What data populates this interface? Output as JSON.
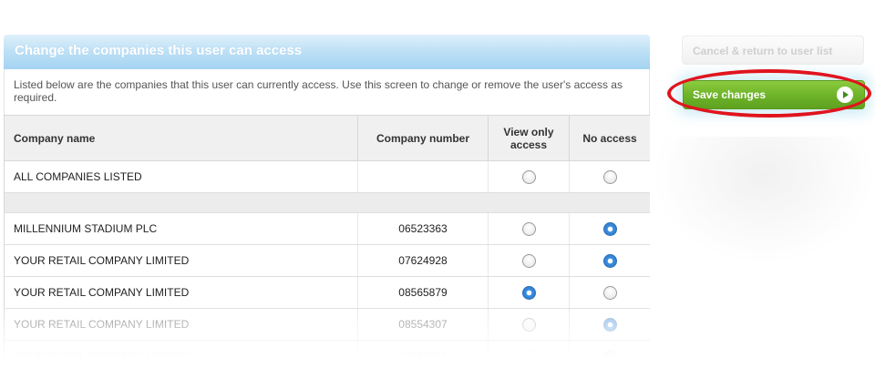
{
  "panel": {
    "title": "Change the companies this user can access",
    "intro": "Listed below are the companies that this user can currently access. Use this screen to change or remove the user's access as required."
  },
  "table": {
    "headers": {
      "company_name": "Company name",
      "company_number": "Company number",
      "view_only": "View only access",
      "no_access": "No access"
    },
    "all_row": {
      "name": "ALL COMPANIES LISTED",
      "view_only": false,
      "no_access": false
    },
    "rows": [
      {
        "name": "MILLENNIUM STADIUM PLC",
        "number": "06523363",
        "selected": "no_access"
      },
      {
        "name": "YOUR RETAIL COMPANY LIMITED",
        "number": "07624928",
        "selected": "no_access"
      },
      {
        "name": "YOUR RETAIL COMPANY LIMITED",
        "number": "08565879",
        "selected": "view_only"
      },
      {
        "name": "YOUR RETAIL COMPANY LIMITED",
        "number": "08554307",
        "selected": "no_access"
      },
      {
        "name": "YOUR RETAIL COMPANY LIMITED",
        "number": "07184321",
        "selected": "no_access"
      }
    ]
  },
  "actions": {
    "cancel_label": "Cancel & return to user list",
    "save_label": "Save changes"
  },
  "colors": {
    "header_blue": "#a4d3f1",
    "save_green": "#6fb42a",
    "radio_selected": "#2a74c9",
    "highlight_red": "#e0141e"
  }
}
